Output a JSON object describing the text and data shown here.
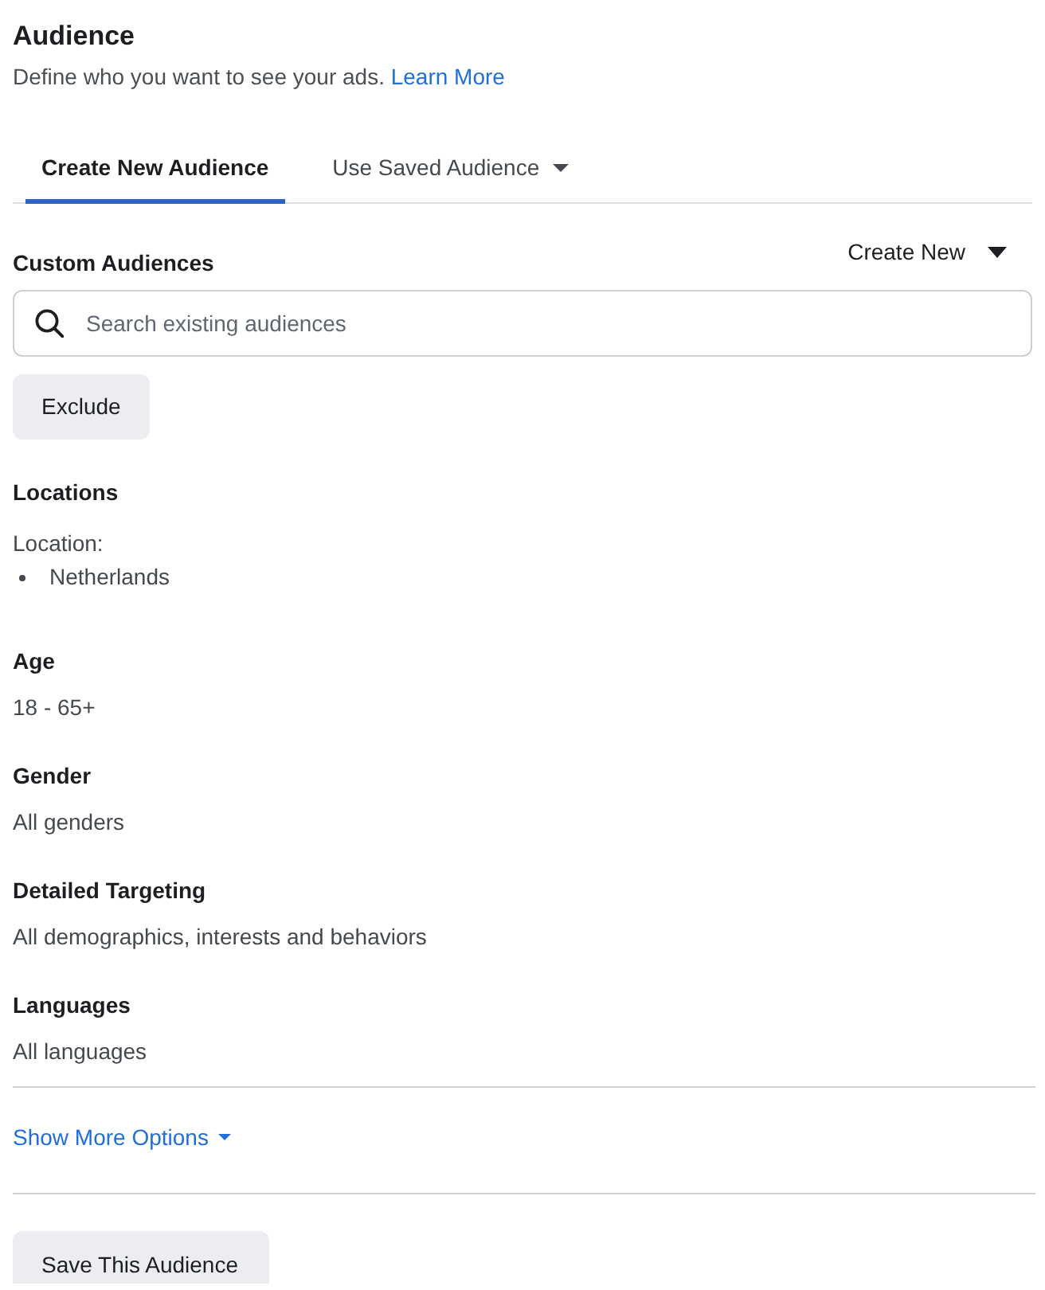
{
  "header": {
    "title": "Audience",
    "description": "Define who you want to see your ads.",
    "link": "Learn More"
  },
  "tabs": [
    {
      "label": "Create New Audience",
      "selected": true,
      "has_menu": false
    },
    {
      "label": "Use Saved Audience",
      "selected": false,
      "has_menu": true
    }
  ],
  "custom_audiences": {
    "title": "Custom Audiences",
    "create_button": "Create New",
    "search": {
      "placeholder": "Search existing audiences"
    },
    "exclude_button": "Exclude"
  },
  "sections": [
    {
      "kind": "list",
      "title": "Locations",
      "label": "Location:",
      "items": [
        "Netherlands"
      ]
    },
    {
      "kind": "text",
      "title": "Age",
      "value": "18 - 65+"
    },
    {
      "kind": "text",
      "title": "Gender",
      "value": "All genders"
    },
    {
      "kind": "text",
      "title": "Detailed Targeting",
      "value": "All demographics, interests and behaviors"
    },
    {
      "kind": "text",
      "title": "Languages",
      "value": "All languages"
    }
  ],
  "footer": {
    "show_more": "Show More Options",
    "save_button": "Save This Audience"
  }
}
